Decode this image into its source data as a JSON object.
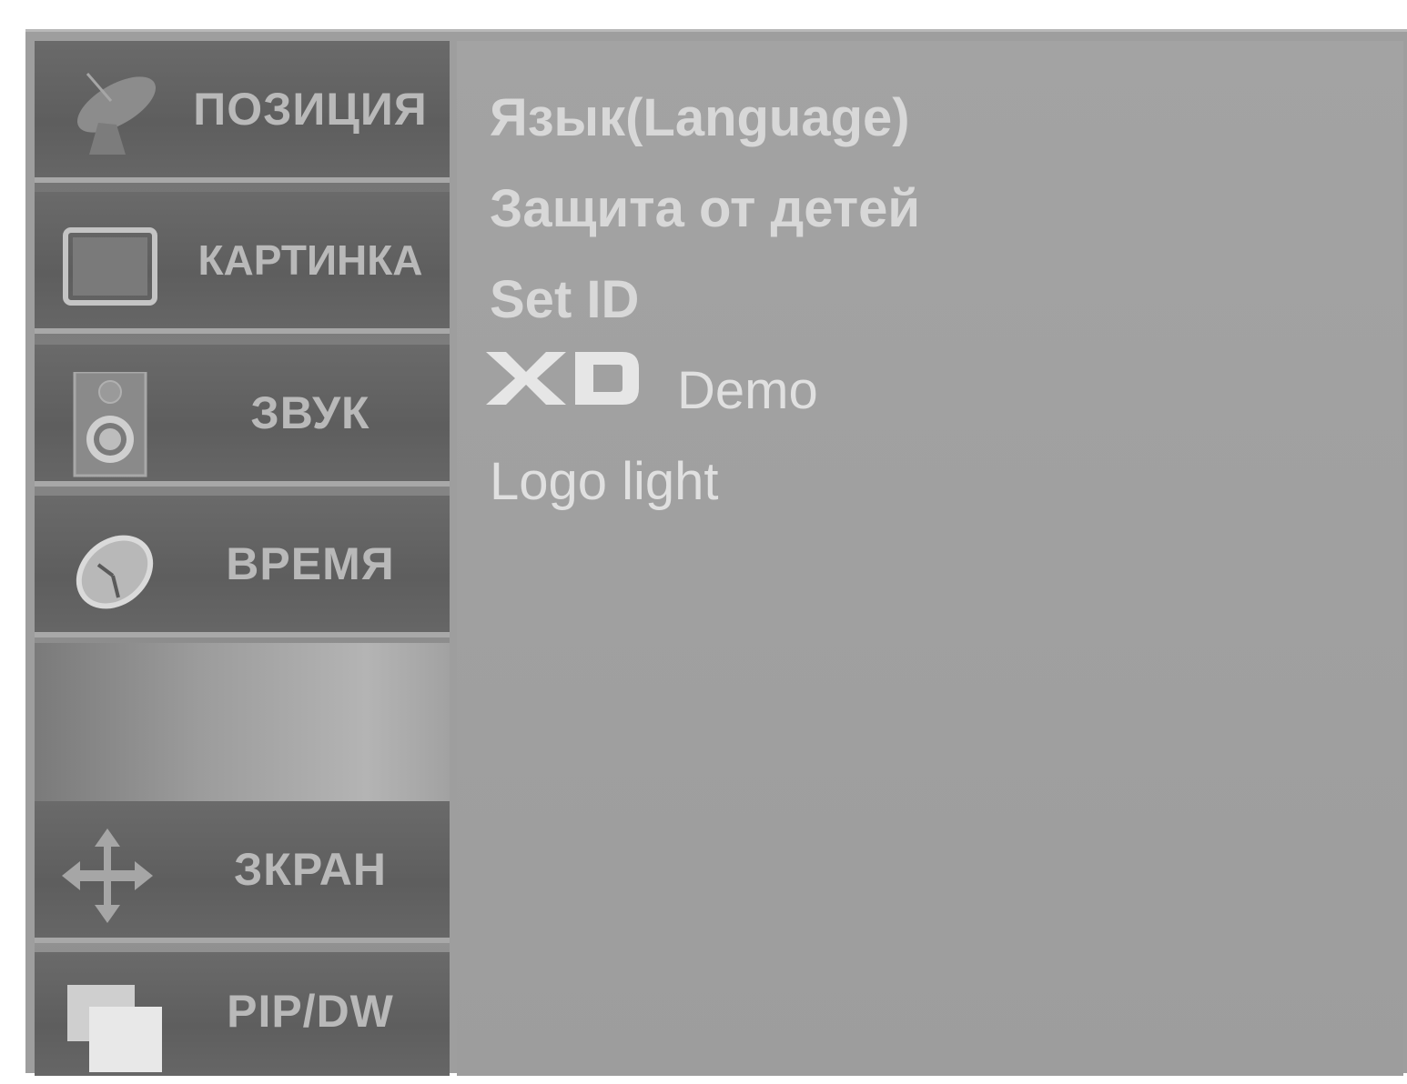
{
  "sidebar": {
    "items": [
      {
        "label": "ПОЗИЦИЯ",
        "icon": "satellite-dish-icon"
      },
      {
        "label": "КАРТИНКА",
        "icon": "picture-frame-icon"
      },
      {
        "label": "ЗВУК",
        "icon": "speaker-icon"
      },
      {
        "label": "ВРЕМЯ",
        "icon": "clock-icon"
      },
      {
        "label": "ЗКРАН",
        "icon": "move-arrows-icon"
      },
      {
        "label": "PIP/DW",
        "icon": "pip-windows-icon"
      }
    ]
  },
  "menu": {
    "language": "Язык(Language)",
    "child_lock": "Защита от детей",
    "set_id": "Set ID",
    "xd_demo": "Demo",
    "xd_demo_logo": "XD",
    "logo_light": "Logo light"
  },
  "colors": {
    "panel": "#9e9e9e",
    "sidebar_item": "#636363",
    "item_text": "#b9b9b9",
    "menu_text": "#d8d8d8"
  }
}
